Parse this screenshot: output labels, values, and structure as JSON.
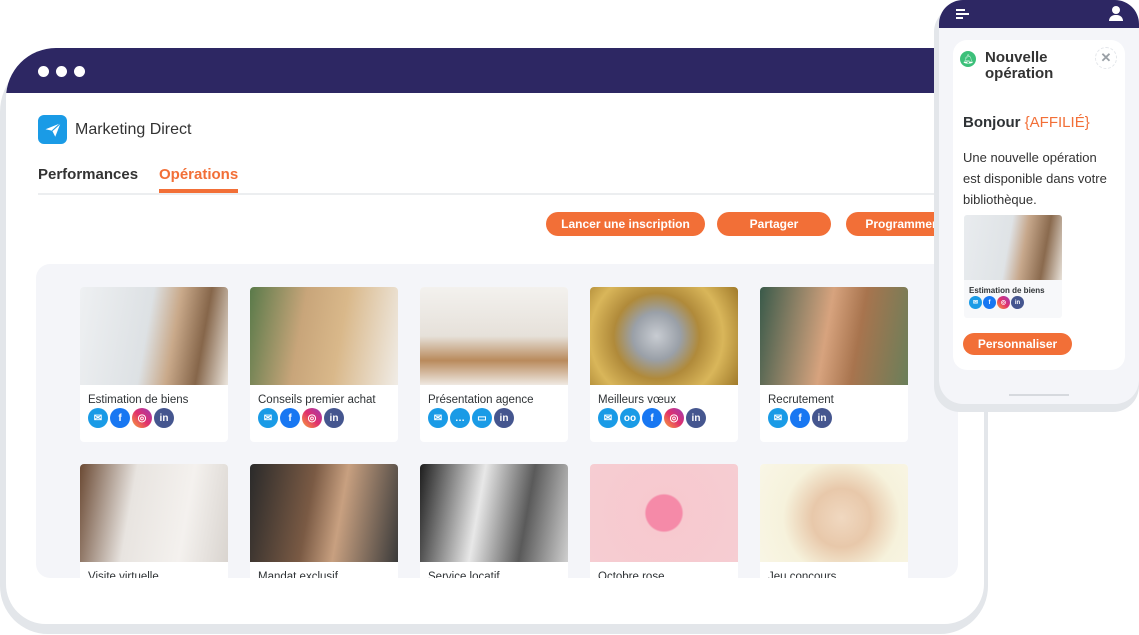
{
  "app": {
    "title": "Marketing Direct",
    "logo_icon": "paper-plane-icon"
  },
  "tabs": [
    {
      "label": "Performances",
      "active": false
    },
    {
      "label": "Opérations",
      "active": true
    }
  ],
  "actions": [
    "Lancer une inscription",
    "Partager",
    "Programmer"
  ],
  "colors": {
    "accent": "#f26f37",
    "header": "#2d2763",
    "brand": "#1a9be6"
  },
  "operations": [
    {
      "title": "Estimation de biens",
      "channels": [
        "email",
        "facebook",
        "instagram",
        "linkedin"
      ]
    },
    {
      "title": "Conseils premier achat",
      "channels": [
        "email",
        "facebook",
        "instagram",
        "linkedin"
      ]
    },
    {
      "title": "Présentation agence",
      "channels": [
        "email",
        "sms",
        "web",
        "linkedin"
      ]
    },
    {
      "title": "Meilleurs vœux",
      "channels": [
        "email",
        "voicemail",
        "facebook",
        "instagram",
        "linkedin"
      ]
    },
    {
      "title": "Recrutement",
      "channels": [
        "email",
        "facebook",
        "linkedin"
      ]
    },
    {
      "title": "Visite virtuelle",
      "channels": []
    },
    {
      "title": "Mandat exclusif",
      "channels": []
    },
    {
      "title": "Service locatif",
      "channels": []
    },
    {
      "title": "Octobre rose",
      "channels": []
    },
    {
      "title": "Jeu concours",
      "channels": []
    }
  ],
  "notification": {
    "title_line1": "Nouvelle",
    "title_line2": "opération",
    "greeting": "Bonjour",
    "placeholder": "{AFFILIÉ}",
    "message": "Une nouvelle opération est disponible dans votre bibliothèque.",
    "preview_title": "Estimation de biens",
    "preview_channels": [
      "email",
      "facebook",
      "instagram",
      "linkedin"
    ],
    "button": "Personnaliser"
  }
}
